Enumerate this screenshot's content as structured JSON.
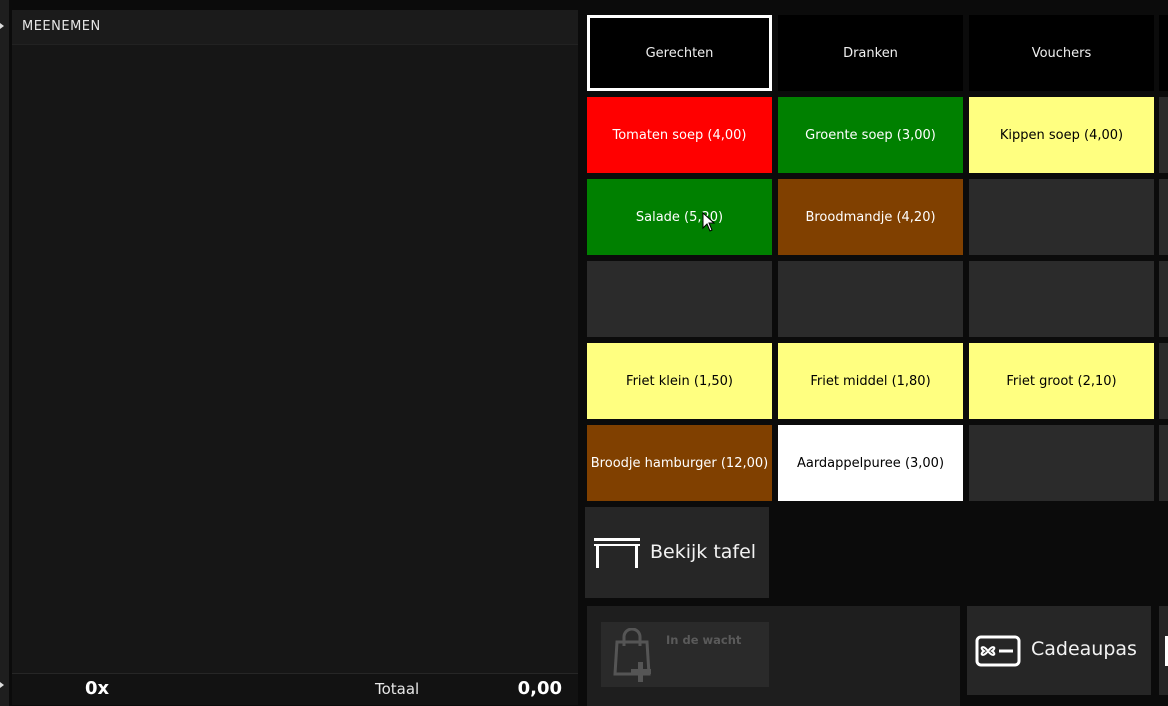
{
  "order": {
    "title": "MEENEMEN",
    "count": "0x",
    "total_label": "Totaal",
    "total_value": "0,00"
  },
  "categories": [
    {
      "label": "Gerechten",
      "active": true
    },
    {
      "label": "Dranken",
      "active": false
    },
    {
      "label": "Vouchers",
      "active": false
    }
  ],
  "products": [
    {
      "label": "Tomaten soep (4,00)",
      "color": "#ff0000",
      "text_color": "#ffffff"
    },
    {
      "label": "Groente soep (3,00)",
      "color": "#008000",
      "text_color": "#ffffff"
    },
    {
      "label": "Kippen soep (4,00)",
      "color": "#ffff80",
      "text_color": "#000000"
    },
    {
      "label": "Salade (5,20)",
      "color": "#008000",
      "text_color": "#ffffff"
    },
    {
      "label": "Broodmandje (4,20)",
      "color": "#804000",
      "text_color": "#ffffff"
    },
    {
      "label": "Friet klein (1,50)",
      "color": "#ffff80",
      "text_color": "#000000"
    },
    {
      "label": "Friet middel (1,80)",
      "color": "#ffff80",
      "text_color": "#000000"
    },
    {
      "label": "Friet groot (2,10)",
      "color": "#ffff80",
      "text_color": "#000000"
    },
    {
      "label": "Broodje hamburger (12,00)",
      "color": "#804000",
      "text_color": "#ffffff"
    },
    {
      "label": "Aardappelpuree (3,00)",
      "color": "#ffffff",
      "text_color": "#000000"
    }
  ],
  "actions": {
    "bekijk_tafel": "Bekijk tafel",
    "in_de_wacht": "In de wacht",
    "cadeaupas": "Cadeaupas"
  }
}
